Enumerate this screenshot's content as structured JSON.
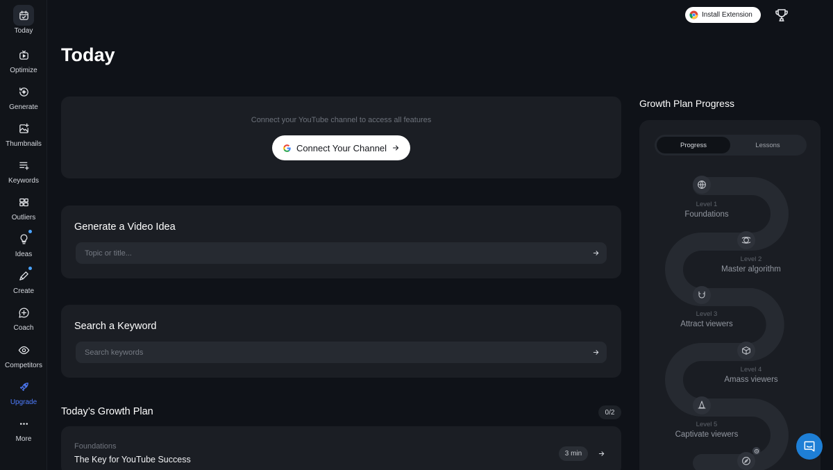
{
  "sidebar": {
    "items": [
      {
        "label": "Today",
        "icon": "calendar-check-icon"
      },
      {
        "label": "Optimize",
        "icon": "tv-play-icon"
      },
      {
        "label": "Generate",
        "icon": "sparkle-refresh-icon"
      },
      {
        "label": "Thumbnails",
        "icon": "image-plus-icon"
      },
      {
        "label": "Keywords",
        "icon": "list-plus-icon"
      },
      {
        "label": "Outliers",
        "icon": "grid-layout-icon"
      },
      {
        "label": "Ideas",
        "icon": "lightbulb-icon"
      },
      {
        "label": "Create",
        "icon": "pen-sparkle-icon"
      },
      {
        "label": "Coach",
        "icon": "chat-plus-icon"
      },
      {
        "label": "Competitors",
        "icon": "eye-icon"
      },
      {
        "label": "Upgrade",
        "icon": "rocket-icon"
      },
      {
        "label": "More",
        "icon": "ellipsis-icon"
      }
    ]
  },
  "header": {
    "install_label": "Install Extension",
    "page_title": "Today"
  },
  "connect": {
    "hint": "Connect your YouTube channel to access all features",
    "button_label": "Connect Your Channel"
  },
  "video_idea": {
    "title": "Generate a Video Idea",
    "placeholder": "Topic or title..."
  },
  "keyword": {
    "title": "Search a Keyword",
    "placeholder": "Search keywords"
  },
  "growth_plan": {
    "title": "Today’s Growth Plan",
    "count": "0/2",
    "lesson": {
      "category": "Foundations",
      "title": "The Key for YouTube Success",
      "duration": "3 min"
    }
  },
  "progress_panel": {
    "title": "Growth Plan Progress",
    "tabs": [
      "Progress",
      "Lessons"
    ],
    "levels": [
      {
        "num": "Level 1",
        "name": "Foundations"
      },
      {
        "num": "Level 2",
        "name": "Master algorithm"
      },
      {
        "num": "Level 3",
        "name": "Attract viewers"
      },
      {
        "num": "Level 4",
        "name": "Amass viewers"
      },
      {
        "num": "Level 5",
        "name": "Captivate viewers"
      }
    ]
  },
  "colors": {
    "background": "#0f1218",
    "card": "#1b1e24",
    "accent_blue": "#4f7dff",
    "chat_button": "#1e7fd6"
  }
}
